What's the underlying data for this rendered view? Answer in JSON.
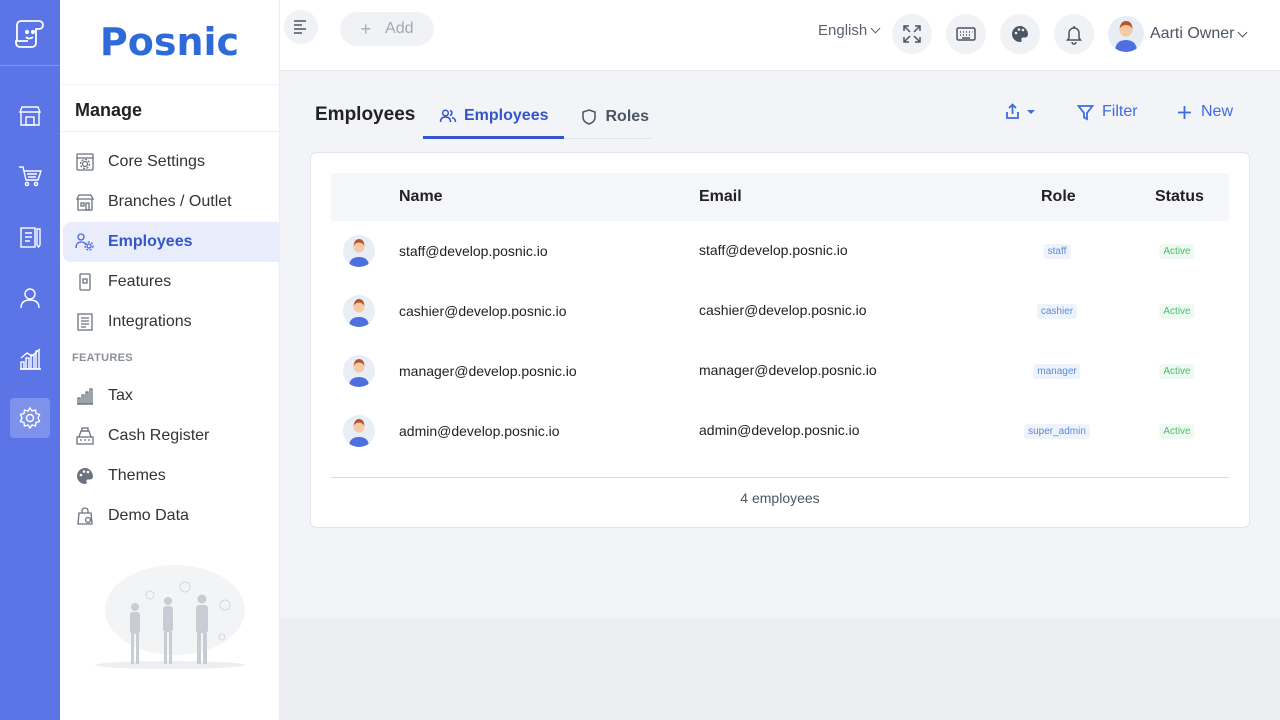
{
  "topbar": {
    "add_label": "Add",
    "language": "English",
    "user_name": "Aarti Owner"
  },
  "sidebar": {
    "brand": "Posnic",
    "heading": "Manage",
    "items": [
      {
        "label": "Core Settings",
        "icon": "settings-panel-icon"
      },
      {
        "label": "Branches / Outlet",
        "icon": "store-icon"
      },
      {
        "label": "Employees",
        "icon": "users-gear-icon",
        "active": true
      },
      {
        "label": "Features",
        "icon": "device-icon"
      },
      {
        "label": "Integrations",
        "icon": "list-doc-icon"
      }
    ],
    "section_label": "FEATURES",
    "feature_items": [
      {
        "label": "Tax",
        "icon": "chart-icon"
      },
      {
        "label": "Cash Register",
        "icon": "register-icon"
      },
      {
        "label": "Themes",
        "icon": "palette-icon"
      },
      {
        "label": "Demo Data",
        "icon": "bag-icon"
      }
    ]
  },
  "rail": {
    "items": [
      "store-icon",
      "cart-icon",
      "clipboard-icon",
      "user-icon",
      "chart-icon",
      "gear-icon"
    ],
    "active_index": 5
  },
  "page": {
    "title": "Employees",
    "tabs": [
      {
        "label": "Employees",
        "active": true
      },
      {
        "label": "Roles",
        "active": false
      }
    ],
    "filter_label": "Filter",
    "new_label": "New"
  },
  "table": {
    "columns": [
      "Name",
      "Email",
      "Role",
      "Status"
    ],
    "rows": [
      {
        "name": "staff@develop.posnic.io",
        "email": "staff@develop.posnic.io",
        "role": "staff",
        "status": "Active"
      },
      {
        "name": "cashier@develop.posnic.io",
        "email": "cashier@develop.posnic.io",
        "role": "cashier",
        "status": "Active"
      },
      {
        "name": "manager@develop.posnic.io",
        "email": "manager@develop.posnic.io",
        "role": "manager",
        "status": "Active"
      },
      {
        "name": "admin@develop.posnic.io",
        "email": "admin@develop.posnic.io",
        "role": "super_admin",
        "status": "Active"
      }
    ],
    "footer": "4 employees"
  },
  "colors": {
    "rail": "#5b74e6",
    "brand": "#2f6bd8",
    "accent": "#3456c9",
    "status_green": "#4bbf6b",
    "role_blue": "#5a8ad8"
  }
}
